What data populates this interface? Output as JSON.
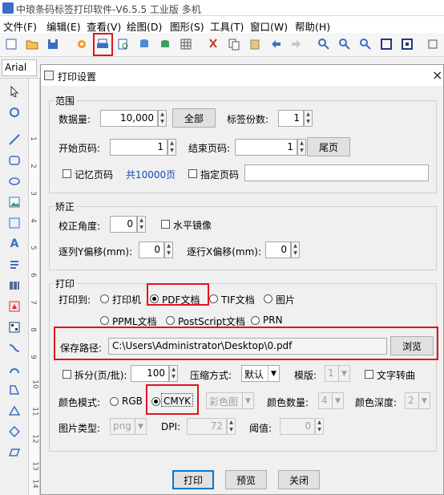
{
  "app": {
    "title": "中琅条码标签打印软件-V6.5.5 工业版 多机"
  },
  "menu": [
    "文件(F)",
    "编辑(E)",
    "查看(V)",
    "绘图(D)",
    "图形(S)",
    "工具(T)",
    "窗口(W)",
    "帮助(H)"
  ],
  "fontbar": {
    "font": "Arial"
  },
  "ruler": [
    "1",
    "2",
    "3",
    "4",
    "5",
    "6",
    "7",
    "8",
    "9",
    "10",
    "11",
    "12",
    "13",
    "14"
  ],
  "dialog": {
    "title": "打印设置",
    "close": "×",
    "range": {
      "group": "范围",
      "count_label": "数据量:",
      "count_value": "10,000",
      "all_button": "全部",
      "copies_label": "标签份数:",
      "copies_value": "1",
      "start_label": "开始页码:",
      "start_value": "1",
      "end_label": "结束页码:",
      "end_value": "1",
      "last_button": "尾页",
      "remember_label": "记忆页码",
      "total_label": "共10000页",
      "specify_label": "指定页码",
      "specify_value": ""
    },
    "correct": {
      "group": "矫正",
      "angle_label": "校正角度:",
      "angle_value": "0",
      "mirror_label": "水平镜像",
      "yoff_label": "逐列Y偏移(mm):",
      "yoff_value": "0",
      "xoff_label": "逐行X偏移(mm):",
      "xoff_value": "0"
    },
    "print": {
      "group": "打印",
      "to_label": "打印到:",
      "targets": [
        "打印机",
        "PDF文档",
        "TIF文档",
        "图片",
        "PPML文档",
        "PostScript文档",
        "PRN"
      ],
      "selected_target": "PDF文档",
      "path_label": "保存路径:",
      "path_value": "C:\\Users\\Administrator\\Desktop\\0.pdf",
      "browse_button": "浏览",
      "split_label": "拆分(页/批):",
      "split_value": "100",
      "compress_label": "压缩方式:",
      "compress_value": "默认",
      "template_label": "模版:",
      "template_value": "1",
      "text_to_curve_label": "文字转曲",
      "color_mode_label": "颜色模式:",
      "rgb_label": "RGB",
      "cmyk_label": "CMYK",
      "selected_color": "CMYK",
      "color_image_value": "彩色图",
      "color_count_label": "颜色数量:",
      "color_count_value": "4",
      "color_depth_label": "颜色深度:",
      "color_depth_value": "2",
      "image_type_label": "图片类型:",
      "image_type_value": "png",
      "dpi_label": "DPI:",
      "dpi_value": "72",
      "threshold_label": "阈值:",
      "threshold_value": "0"
    },
    "buttons": {
      "print": "打印",
      "preview": "预览",
      "close": "关闭"
    }
  },
  "colors": {
    "accent": "#1a47b8",
    "highlight": "#e0141e"
  }
}
